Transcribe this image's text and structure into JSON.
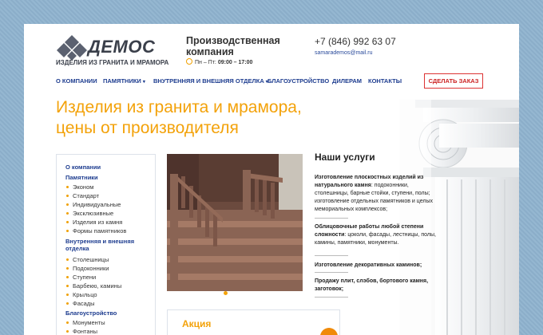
{
  "brand": {
    "name": "ДЕМОС",
    "tagline": "ИЗДЕЛИЯ ИЗ ГРАНИТА И МРАМОРА",
    "accent_color": "#f3a20a",
    "link_color": "#1d3c8f"
  },
  "header": {
    "company": "Производственная компания",
    "hours_prefix": "Пн – Пт:",
    "hours_time": "09:00 – 17:00",
    "phone": "+7 (846) 992 63 07",
    "email": "samarademos@mail.ru"
  },
  "nav": {
    "items": [
      {
        "label": "О КОМПАНИИ"
      },
      {
        "label": "ПАМЯТНИКИ",
        "caret": "▾"
      },
      {
        "label": "ВНУТРЕННЯЯ И ВНЕШНЯЯ ОТДЕЛКА",
        "caret": "▾"
      },
      {
        "label": "БЛАГОУСТРОЙСТВО"
      },
      {
        "label": "ДИЛЕРАМ"
      },
      {
        "label": "КОНТАКТЫ"
      }
    ],
    "order_button": "СДЕЛАТЬ ЗАКАЗ"
  },
  "hero": {
    "title_line1": "Изделия из гранита и мрамора,",
    "title_line2": "цены от производителя"
  },
  "sidebar": {
    "about": "О компании",
    "monuments": "Памятники",
    "monument_items": [
      "Эконом",
      "Стандарт",
      "Индивидуальные",
      "Эксклюзивные",
      "Изделия из камня",
      "Формы памятников"
    ],
    "finishing": "Внутренняя и внешняя отделка",
    "finishing_items": [
      "Столешницы",
      "Подоконники",
      "Ступени",
      "Барбекю, камины",
      "Крыльцо",
      "Фасады"
    ],
    "landscaping": "Благоустройство",
    "landscaping_items": [
      "Монументы",
      "Фонтаны"
    ]
  },
  "slider": {
    "dots": 3,
    "active_dot": 0
  },
  "services": {
    "title": "Наши услуги",
    "s1_bold": "Изготовление плоскостных изделий из натурального камня",
    "s1_rest": ": подоконники, столешницы, барные стойки, ступени, полы; изготовление отдельных памятников и целых мемориальных комплексов;",
    "s2_bold": "Облицовочные работы любой степени сложности",
    "s2_rest": ": цоколи, фасады, лестницы, полы, камины, памятники, монументы.",
    "s3_bold": "Изготовление декоративных каминов;",
    "s4_bold": "Продажу плит, слэбов, бортового камня, заготовок;"
  },
  "promo": {
    "title": "Акция"
  }
}
